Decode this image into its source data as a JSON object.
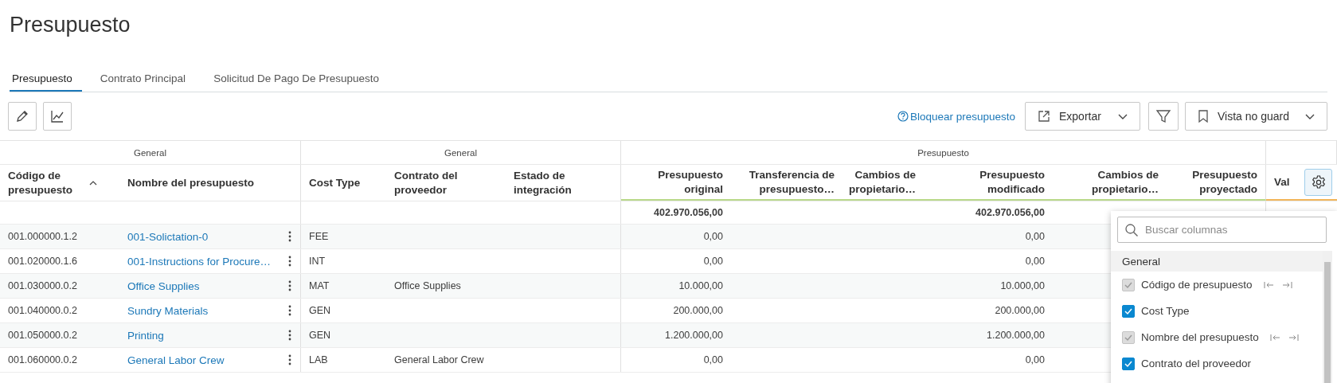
{
  "title": "Presupuesto",
  "tabs": [
    {
      "label": "Presupuesto",
      "selected": true
    },
    {
      "label": "Contrato Principal",
      "selected": false
    },
    {
      "label": "Solicitud De Pago De Presupuesto",
      "selected": false
    }
  ],
  "toolbar": {
    "help_link": "Bloquear presupuesto",
    "export_button": "Exportar",
    "view_dropdown": "Vista no guard"
  },
  "table": {
    "groups": [
      {
        "label": "General"
      },
      {
        "label": "General"
      },
      {
        "label": "Presupuesto"
      }
    ],
    "columns": [
      {
        "label": "Código de presupuesto",
        "sorted": true
      },
      {
        "label": "Nombre del presupuesto"
      },
      {},
      {
        "label": "Cost Type"
      },
      {
        "label": "Contrato del proveedor"
      },
      {
        "label": "Estado de integración"
      },
      {
        "label": "Presupuesto original"
      },
      {
        "label": "Transferencia de presupuesto…"
      },
      {
        "label": "Cambios de propietario…"
      },
      {
        "label": "Presupuesto modificado"
      },
      {
        "label": "Cambios de propietario…"
      },
      {
        "label": "Presupuesto proyectado"
      },
      {
        "label": "Val"
      }
    ],
    "totals": {
      "original": "402.970.056,00",
      "modified": "402.970.056,00"
    },
    "rows": [
      {
        "code": "001.000000.1.2",
        "name": "001-Solictation-0",
        "cost_type": "FEE",
        "contract": "",
        "original": "0,00",
        "modified": "0,00"
      },
      {
        "code": "001.020000.1.6",
        "name": "001-Instructions for Procure…",
        "cost_type": "INT",
        "contract": "",
        "original": "0,00",
        "modified": "0,00"
      },
      {
        "code": "001.030000.0.2",
        "name": "Office Supplies",
        "cost_type": "MAT",
        "contract": "Office Supplies",
        "original": "10.000,00",
        "modified": "10.000,00"
      },
      {
        "code": "001.040000.0.2",
        "name": "Sundry Materials",
        "cost_type": "GEN",
        "contract": "",
        "original": "200.000,00",
        "modified": "200.000,00"
      },
      {
        "code": "001.050000.0.2",
        "name": "Printing",
        "cost_type": "GEN",
        "contract": "",
        "original": "1.200.000,00",
        "modified": "1.200.000,00"
      },
      {
        "code": "001.060000.0.2",
        "name": "General Labor Crew",
        "cost_type": "LAB",
        "contract": "General Labor Crew",
        "original": "0,00",
        "modified": "0,00"
      }
    ]
  },
  "column_menu": {
    "search": {
      "placeholder": "Buscar columnas"
    },
    "section": "General",
    "items": [
      {
        "label": "Código de presupuesto",
        "checked": true,
        "disabled": true,
        "pinnable": true
      },
      {
        "label": "Cost Type",
        "checked": true,
        "disabled": false,
        "pinnable": false
      },
      {
        "label": "Nombre del presupuesto",
        "checked": true,
        "disabled": true,
        "pinnable": true
      },
      {
        "label": "Contrato del proveedor",
        "checked": true,
        "disabled": false,
        "pinnable": false
      }
    ]
  }
}
